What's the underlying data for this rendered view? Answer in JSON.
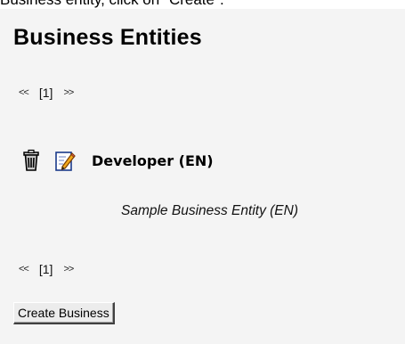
{
  "header_text": "Business entity, click on \"Create\".",
  "panel": {
    "title": "Business Entities",
    "pager_top": {
      "prev": "<<",
      "page": "[1]",
      "next": ">>"
    },
    "pager_bottom": {
      "prev": "<<",
      "page": "[1]",
      "next": ">>"
    },
    "entity": {
      "name": "Developer (EN)",
      "description": "Sample Business Entity (EN)",
      "delete_icon": "trash-icon",
      "edit_icon": "edit-icon"
    },
    "create_button_label": "Create Business"
  }
}
